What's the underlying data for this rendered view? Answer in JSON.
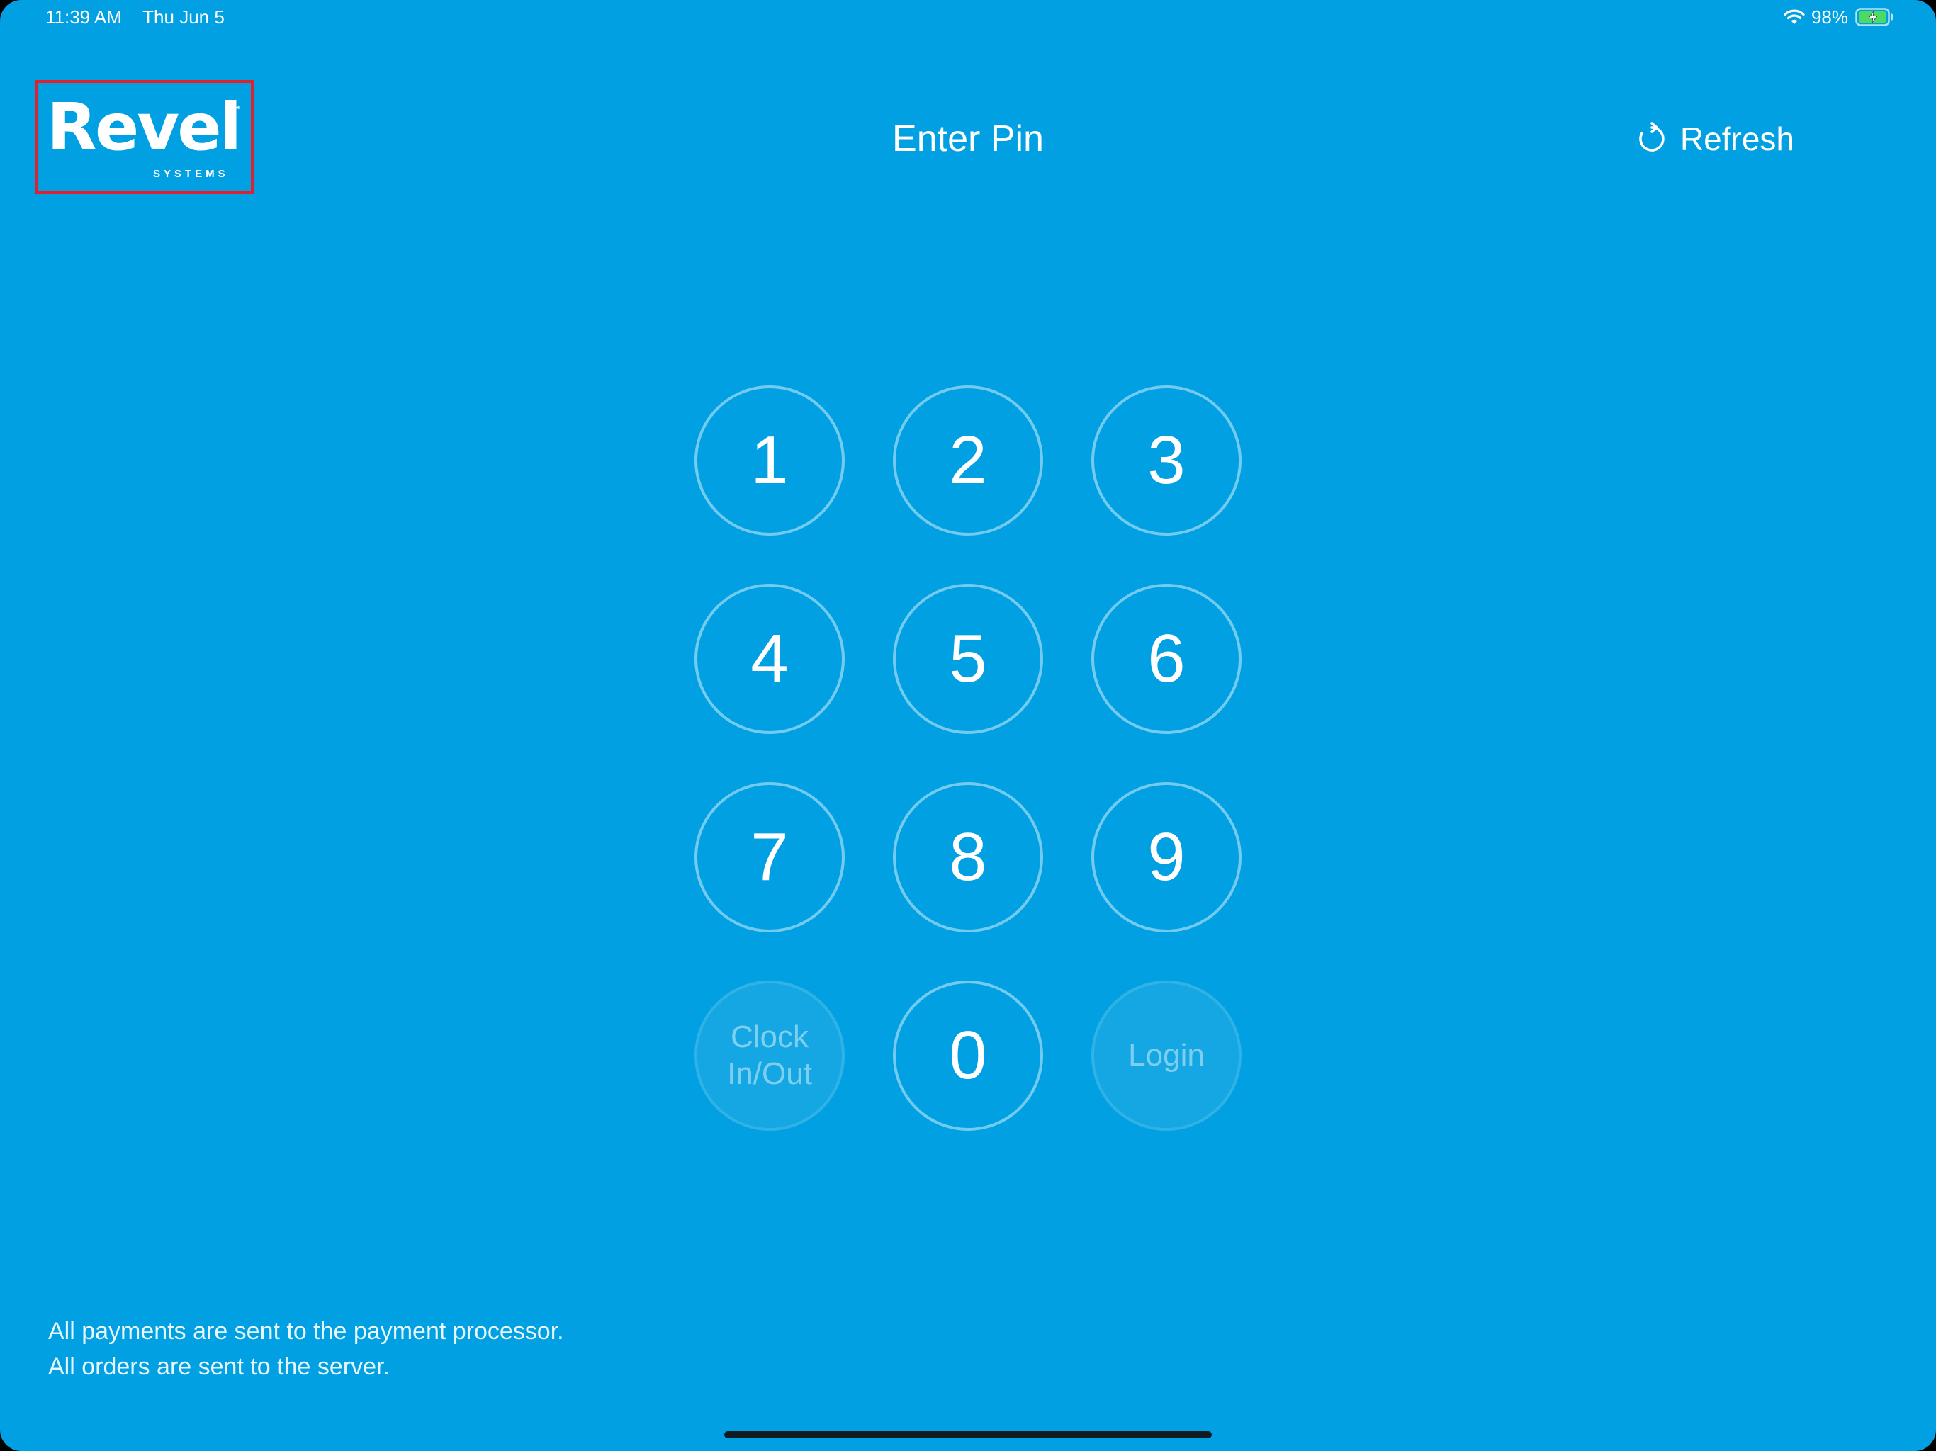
{
  "status_bar": {
    "time": "11:39 AM",
    "date": "Thu Jun 5",
    "battery_percent": "98%",
    "wifi_icon": "wifi-icon",
    "battery_icon": "battery-charging-icon"
  },
  "header": {
    "logo_text": "Revel",
    "logo_tm": "™",
    "logo_subtext": "SYSTEMS",
    "title": "Enter Pin",
    "refresh_label": "Refresh",
    "refresh_icon": "refresh-icon"
  },
  "keypad": {
    "keys": [
      "1",
      "2",
      "3",
      "4",
      "5",
      "6",
      "7",
      "8",
      "9"
    ],
    "clock_label": "Clock\nIn/Out",
    "zero_label": "0",
    "login_label": "Login"
  },
  "footer": {
    "line1": "All payments are sent to the payment processor.",
    "line2": "All orders are sent to the server."
  },
  "colors": {
    "background": "#01A0E2",
    "logo_highlight_border": "#E0202E"
  }
}
